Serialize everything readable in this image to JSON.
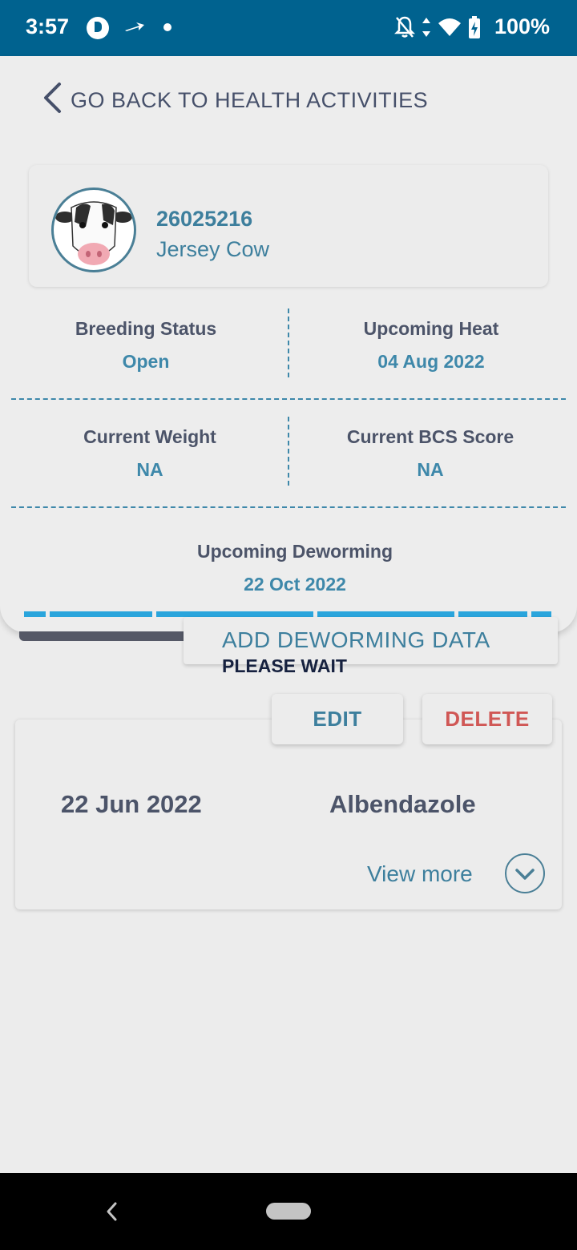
{
  "status_bar": {
    "time": "3:57",
    "battery": "100%",
    "icons": [
      "app-icon",
      "navigation-arrow-icon",
      "notification-dot",
      "notifications-off-icon",
      "data-arrows-icon",
      "wifi-icon",
      "battery-charging-icon"
    ]
  },
  "header": {
    "back_label": "GO BACK TO HEALTH ACTIVITIES"
  },
  "animal": {
    "id": "26025216",
    "breed": "Jersey  Cow",
    "avatar": "cow-avatar"
  },
  "stats": {
    "breeding_status": {
      "label": "Breeding Status",
      "value": "Open"
    },
    "upcoming_heat": {
      "label": "Upcoming Heat",
      "value": "04 Aug 2022"
    },
    "current_weight": {
      "label": "Current Weight",
      "value": "NA"
    },
    "current_bcs": {
      "label": "Current BCS Score",
      "value": "NA"
    },
    "upcoming_deworming": {
      "label": "Upcoming Deworming",
      "value": "22 Oct 2022"
    }
  },
  "actions": {
    "add_label": "ADD DEWORMING DATA",
    "wait_label": "PLEASE WAIT",
    "edit_label": "EDIT",
    "delete_label": "DELETE"
  },
  "record": {
    "date": "22 Jun 2022",
    "medicine": "Albendazole",
    "view_more": "View more"
  },
  "colors": {
    "status_bar": "#00628f",
    "accent": "#3d7f9d",
    "danger": "#d05755",
    "progress": "#2aa5dc"
  }
}
